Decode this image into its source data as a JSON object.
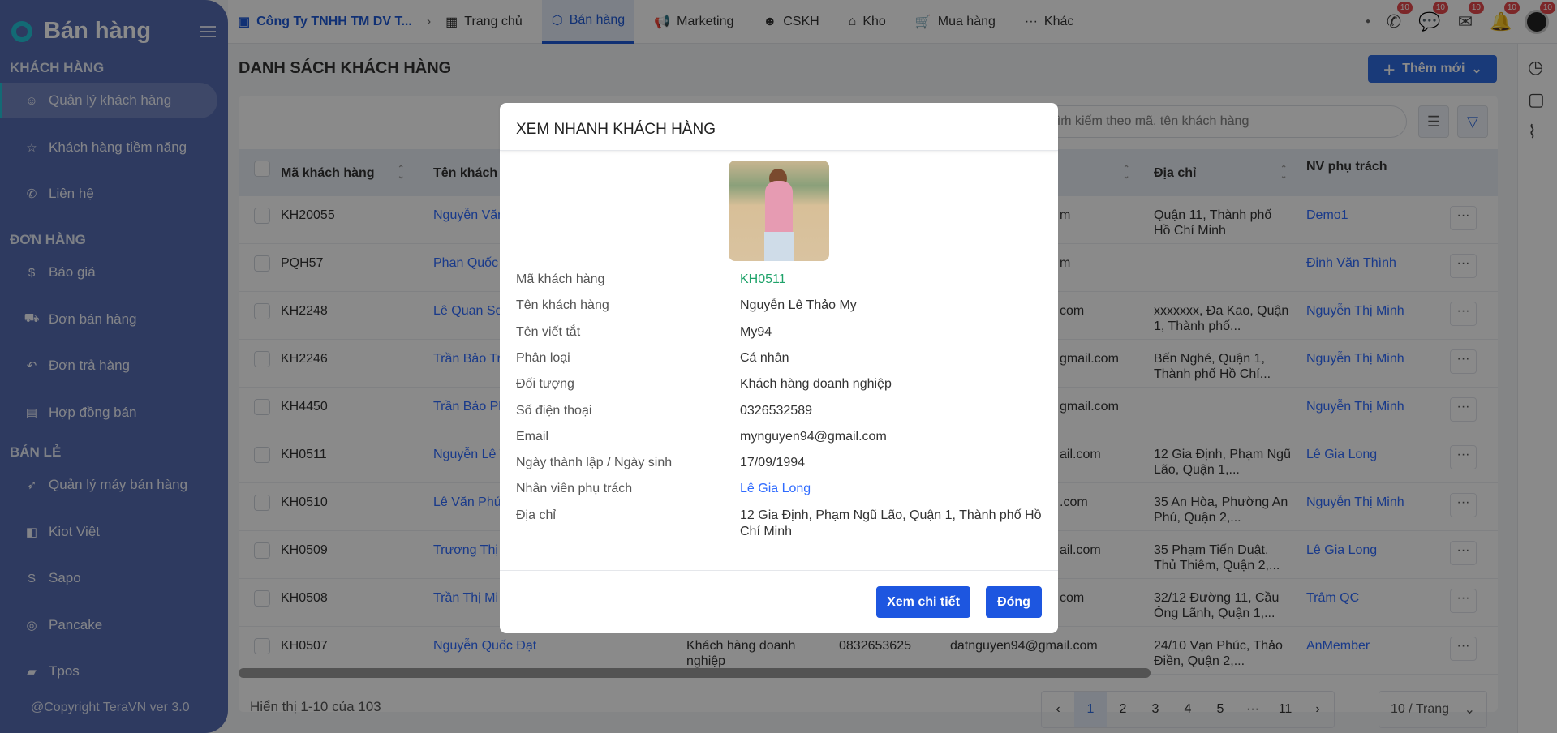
{
  "sidebar": {
    "title": "Bán hàng",
    "copyright": "@Copyright TeraVN ver 3.0",
    "sections": [
      {
        "label": "KHÁCH HÀNG",
        "items": [
          {
            "label": "Quản lý khách hàng",
            "icon": "users-icon",
            "active": true
          },
          {
            "label": "Khách hàng tiềm năng",
            "icon": "star-icon"
          },
          {
            "label": "Liên hệ",
            "icon": "phone-icon"
          }
        ]
      },
      {
        "label": "ĐƠN HÀNG",
        "items": [
          {
            "label": "Báo giá",
            "icon": "dollar-icon"
          },
          {
            "label": "Đơn bán hàng",
            "icon": "truck-icon"
          },
          {
            "label": "Đơn trả hàng",
            "icon": "return-icon"
          },
          {
            "label": "Hợp đồng bán",
            "icon": "contract-icon"
          }
        ]
      },
      {
        "label": "BÁN LẺ",
        "items": [
          {
            "label": "Quản lý máy bán hàng",
            "icon": "rocket-icon"
          },
          {
            "label": "Kiot Việt",
            "icon": "kiotviet-icon"
          },
          {
            "label": "Sapo",
            "icon": "sapo-icon"
          },
          {
            "label": "Pancake",
            "icon": "pancake-icon"
          },
          {
            "label": "Tpos",
            "icon": "tpos-icon"
          }
        ]
      }
    ]
  },
  "topbar": {
    "company": "Công Ty TNHH TM DV T...",
    "nav": [
      {
        "label": "Trang chủ",
        "icon": "grid-icon"
      },
      {
        "label": "Bán hàng",
        "icon": "box-icon",
        "active": true
      },
      {
        "label": "Marketing",
        "icon": "megaphone-icon"
      },
      {
        "label": "CSKH",
        "icon": "support-icon"
      },
      {
        "label": "Kho",
        "icon": "warehouse-icon"
      },
      {
        "label": "Mua hàng",
        "icon": "cart-icon"
      },
      {
        "label": "Khác",
        "icon": "more-icon"
      }
    ],
    "icons": [
      {
        "name": "phone-icon",
        "badge": "10"
      },
      {
        "name": "chat-icon",
        "badge": "10"
      },
      {
        "name": "mail-icon",
        "badge": "10"
      },
      {
        "name": "bell-icon",
        "badge": "10"
      }
    ],
    "avatar_badge": "10"
  },
  "page": {
    "title": "DANH SÁCH KHÁCH HÀNG",
    "add_button": "Thêm mới",
    "search_placeholder": "Tìm kiếm theo mã, tên khách hàng",
    "search_visible": "h kiếm theo mã, tên khách hàng"
  },
  "table": {
    "headers": {
      "code": "Mã khách hàng",
      "name": "Tên khách h",
      "address": "Địa chỉ",
      "staff": "NV phụ trách"
    },
    "rows": [
      {
        "code": "KH20055",
        "name": "Nguyễn Văn",
        "type": "",
        "phone": "",
        "email": "m",
        "address": "Quận 11, Thành phố Hồ Chí Minh",
        "staff": "Demo1"
      },
      {
        "code": "PQH57",
        "name": "Phan Quốc",
        "type": "",
        "phone": "",
        "email": "m",
        "address": "",
        "staff": "Đinh Văn Thình"
      },
      {
        "code": "KH2248",
        "name": "Lê Quan Sơ",
        "type": "",
        "phone": "",
        "email": "com",
        "address": "xxxxxxx, Đa Kao, Quận 1, Thành phố...",
        "staff": "Nguyễn Thị Minh"
      },
      {
        "code": "KH2246",
        "name": "Trần Bảo Tr",
        "type": "",
        "phone": "",
        "email": "gmail.com",
        "address": "Bến Nghé, Quận 1, Thành phố Hồ Chí...",
        "staff": "Nguyễn Thị Minh"
      },
      {
        "code": "KH4450",
        "name": "Trần Bảo Ph",
        "type": "",
        "phone": "",
        "email": "gmail.com",
        "address": "",
        "staff": "Nguyễn Thị Minh"
      },
      {
        "code": "KH0511",
        "name": "Nguyễn Lê T",
        "type": "",
        "phone": "",
        "email": "ail.com",
        "address": "12 Gia Định, Phạm Ngũ Lão, Quận 1,...",
        "staff": "Lê Gia Long"
      },
      {
        "code": "KH0510",
        "name": "Lê Văn Phú",
        "type": "",
        "phone": "",
        "email": ".com",
        "address": "35 An Hòa, Phường An Phú, Quận 2,...",
        "staff": "Nguyễn Thị Minh"
      },
      {
        "code": "KH0509",
        "name": "Trương Thị",
        "type": "",
        "phone": "",
        "email": "ail.com",
        "address": "35 Phạm Tiến Duật, Thủ Thiêm, Quận 2,...",
        "staff": "Lê Gia Long"
      },
      {
        "code": "KH0508",
        "name": "Trần Thị Mi",
        "type": "",
        "phone": "",
        "email": "com",
        "address": "32/12 Đường 11, Cầu Ông Lãnh, Quận 1,...",
        "staff": "Trâm QC"
      },
      {
        "code": "KH0507",
        "name": "Nguyễn Quốc Đạt",
        "type": "Khách hàng doanh nghiệp",
        "phone": "0832653625",
        "email": "datnguyen94@gmail.com",
        "address": "24/10 Vạn Phúc, Thảo Điền, Quận 2,...",
        "staff": "AnMember"
      }
    ]
  },
  "footer": {
    "summary": "Hiển thị 1-10 của 103",
    "pages": [
      "1",
      "2",
      "3",
      "4",
      "5",
      "···",
      "11"
    ],
    "current_page": "1",
    "per_page": "10 / Trang"
  },
  "modal": {
    "title": "XEM NHANH KHÁCH HÀNG",
    "fields": [
      {
        "label": "Mã khách hàng",
        "value": "KH0511",
        "style": "green"
      },
      {
        "label": "Tên khách hàng",
        "value": "Nguyễn Lê Thảo My"
      },
      {
        "label": "Tên viết tắt",
        "value": "My94"
      },
      {
        "label": "Phân loại",
        "value": "Cá nhân"
      },
      {
        "label": "Đối tượng",
        "value": "Khách hàng doanh nghiệp"
      },
      {
        "label": "Số điện thoại",
        "value": "0326532589"
      },
      {
        "label": "Email",
        "value": "mynguyen94@gmail.com"
      },
      {
        "label": "Ngày thành lập / Ngày sinh",
        "value": "17/09/1994"
      },
      {
        "label": "Nhân viên phụ trách",
        "value": "Lê Gia Long",
        "style": "link"
      },
      {
        "label": "Địa chỉ",
        "value": "12 Gia Định, Phạm Ngũ Lão, Quận 1, Thành phố Hồ Chí Minh"
      }
    ],
    "detail_button": "Xem chi tiết",
    "close_button": "Đóng"
  },
  "colors": {
    "accent": "#1d56e0",
    "link": "#2f6bff",
    "code_green": "#1fa36a",
    "sidebar": "#556bb2"
  }
}
